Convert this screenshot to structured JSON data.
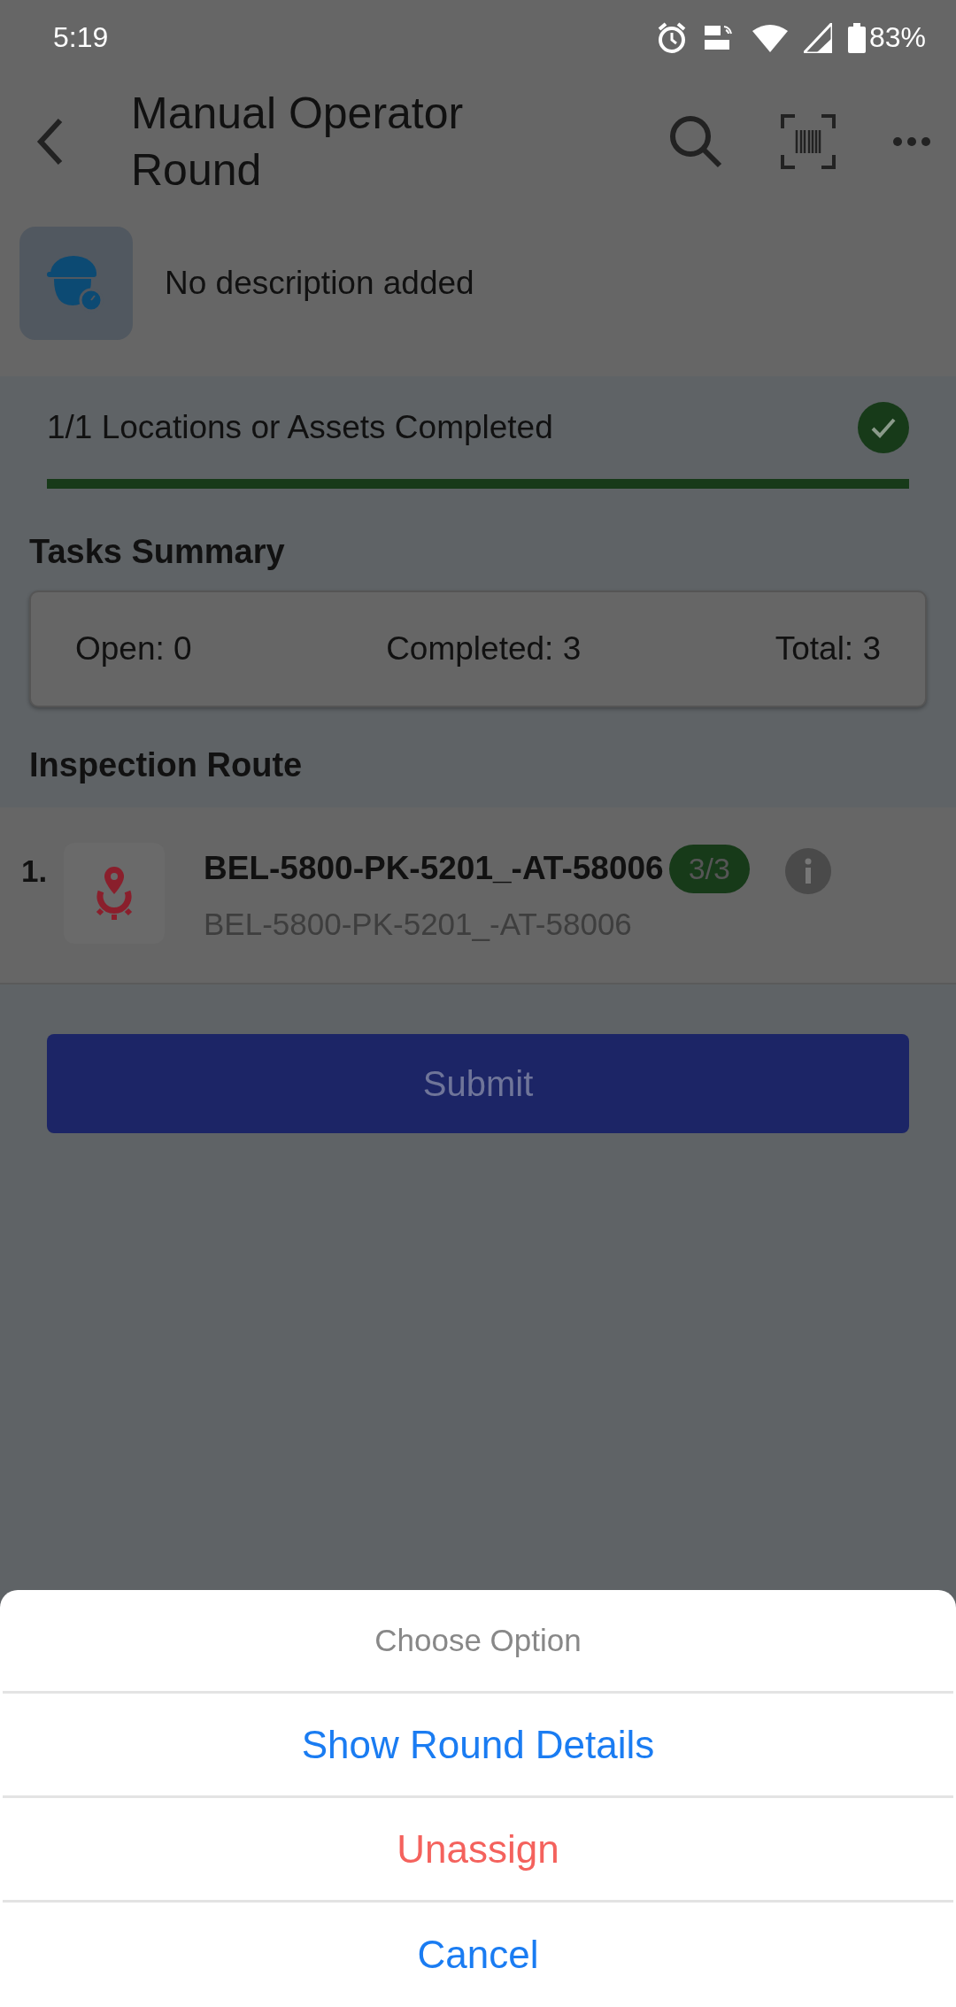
{
  "status_bar": {
    "time": "5:19",
    "battery": "83%"
  },
  "header": {
    "title": "Manual Operator Round"
  },
  "description": "No description added",
  "progress": {
    "label": "1/1 Locations or Assets Completed",
    "completed": true,
    "level": 1
  },
  "tasks_summary": {
    "title": "Tasks Summary",
    "items": [
      "Open: 0",
      "Completed: 3",
      "Total: 3"
    ]
  },
  "inspection_route": {
    "title": "Inspection Route",
    "items": [
      {
        "index": "1.",
        "name": "BEL-5800-PK-5201_-AT-58006",
        "subtitle": "BEL-5800-PK-5201_-AT-58006",
        "badge": "3/3"
      }
    ]
  },
  "submit": {
    "label": "Submit",
    "disabled": true
  },
  "sheet": {
    "title": "Choose Option",
    "options": [
      {
        "label": "Show Round Details",
        "kind": "default"
      },
      {
        "label": "Unassign",
        "kind": "destructive"
      },
      {
        "label": "Cancel",
        "kind": "default"
      }
    ]
  }
}
